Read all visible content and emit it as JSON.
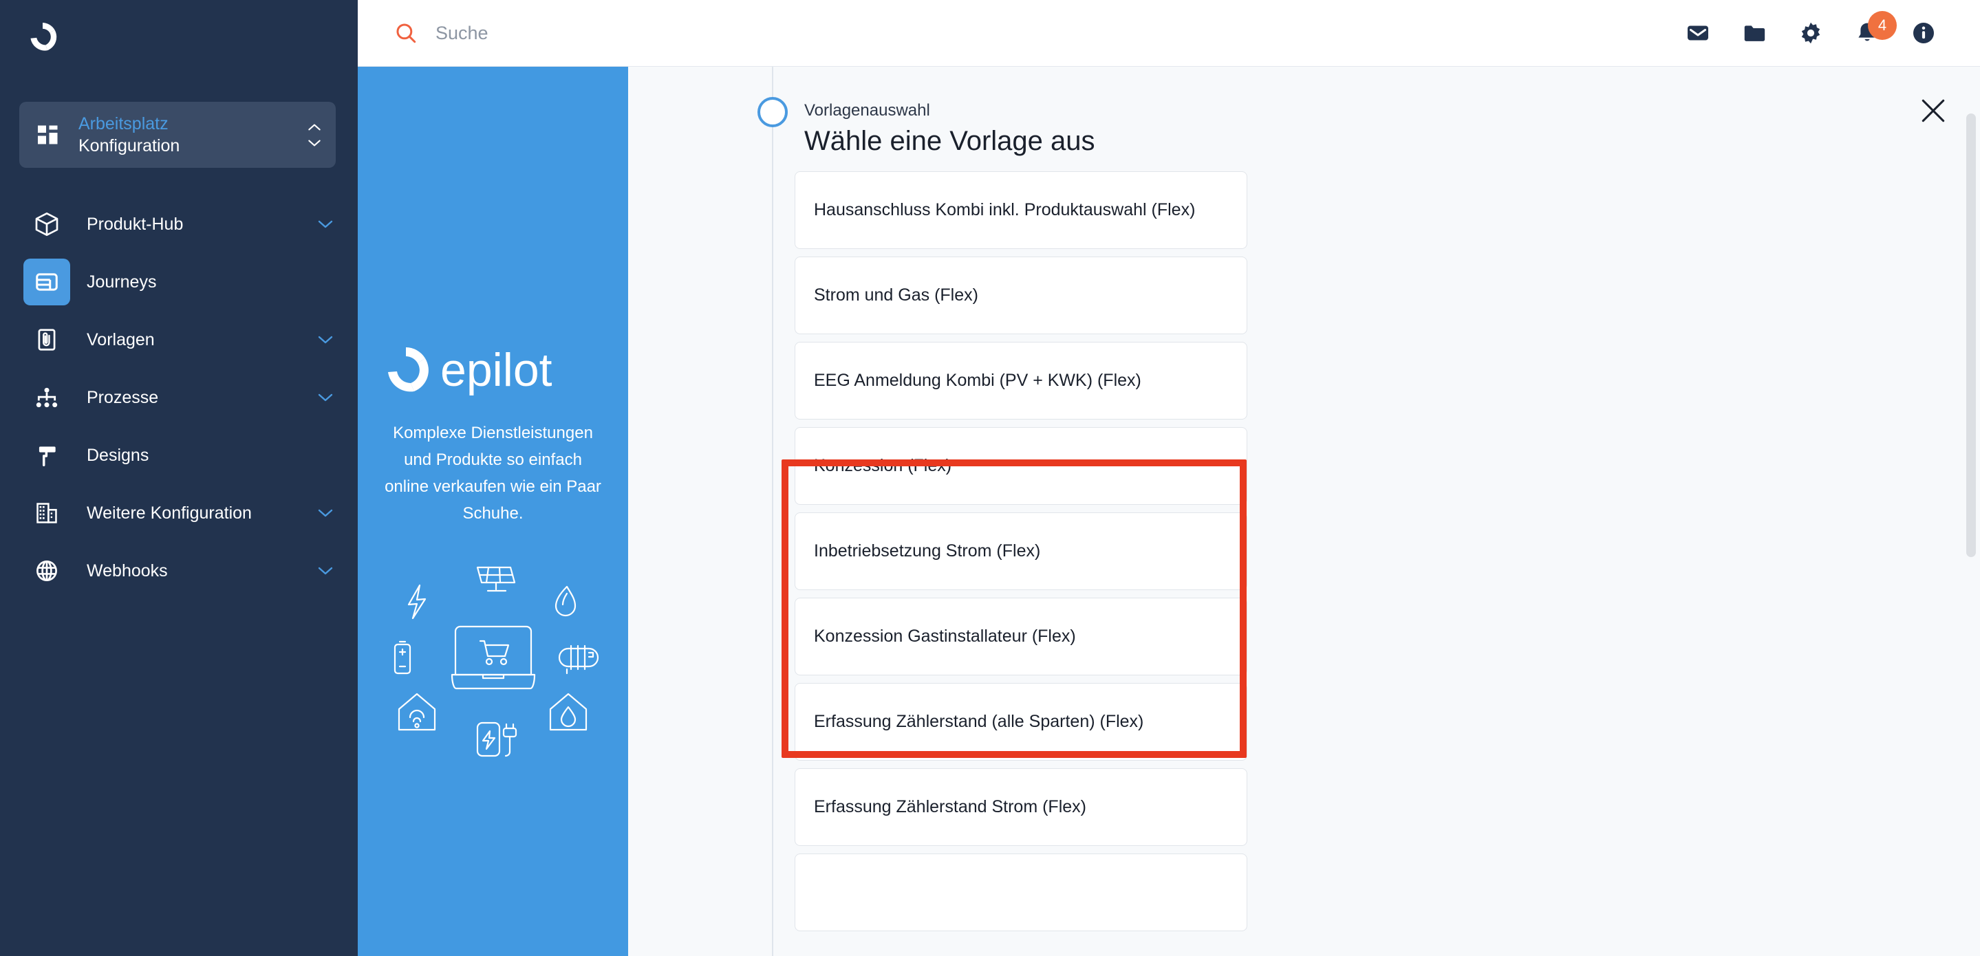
{
  "colors": {
    "sidebar_bg": "#22334e",
    "sidebar_card_bg": "#3a4b66",
    "accent_blue": "#4a9ae0",
    "promo_blue": "#4299e1",
    "search_icon_orange": "#f0613f",
    "badge_orange": "#f0713f",
    "annotation_red": "#e8391f",
    "content_bg": "#f7f9fb"
  },
  "sidebar": {
    "logo_name": "epilot-logo-icon",
    "workspace": {
      "icon": "grid-dashboard-icon",
      "top_label": "Arbeitsplatz",
      "bottom_label": "Konfiguration",
      "chevron_up_icon": "chevron-up-icon",
      "chevron_down_icon": "chevron-down-icon"
    },
    "items": [
      {
        "label": "Produkt-Hub",
        "icon": "cube-box-icon",
        "has_chevron": true,
        "active": false
      },
      {
        "label": "Journeys",
        "icon": "layout-panels-icon",
        "has_chevron": false,
        "active": true
      },
      {
        "label": "Vorlagen",
        "icon": "document-attachment-icon",
        "has_chevron": true,
        "active": false
      },
      {
        "label": "Prozesse",
        "icon": "hierarchy-nodes-icon",
        "has_chevron": true,
        "active": false
      },
      {
        "label": "Designs",
        "icon": "paint-roller-icon",
        "has_chevron": false,
        "active": false
      },
      {
        "label": "Weitere Konfiguration",
        "icon": "office-building-icon",
        "has_chevron": true,
        "active": false
      },
      {
        "label": "Webhooks",
        "icon": "globe-icon",
        "has_chevron": true,
        "active": false
      }
    ]
  },
  "topbar": {
    "search": {
      "icon": "search-icon",
      "placeholder": "Suche",
      "value": ""
    },
    "icons": [
      {
        "name": "mail-envelope-icon",
        "badge": ""
      },
      {
        "name": "folder-icon",
        "badge": ""
      },
      {
        "name": "gear-settings-icon",
        "badge": ""
      },
      {
        "name": "bell-notification-icon",
        "badge": "4"
      },
      {
        "name": "info-circle-icon",
        "badge": ""
      }
    ]
  },
  "promo": {
    "logo_text": "epilot",
    "logo_icon": "epilot-wordmark",
    "tagline": "Komplexe Dienstleistungen und Produkte so einfach online verkaufen wie ein Paar Schuhe.",
    "illustration_icons": [
      "solar-panel-icon",
      "flame-gas-icon",
      "lightning-bolt-icon",
      "battery-icon",
      "radiator-heating-icon",
      "laptop-shopping-cart-icon",
      "smart-home-wifi-icon",
      "water-house-icon",
      "ev-charger-icon"
    ]
  },
  "main": {
    "step_label": "Vorlagenauswahl",
    "step_dot_icon": "step-circle-empty-icon",
    "title": "Wähle eine Vorlage aus",
    "close_icon": "close-x-icon",
    "templates": [
      {
        "label": "Hausanschluss Kombi inkl. Produktauswahl (Flex)",
        "highlighted": false
      },
      {
        "label": "Strom und Gas (Flex)",
        "highlighted": false
      },
      {
        "label": "EEG Anmeldung Kombi (PV + KWK) (Flex)",
        "highlighted": false
      },
      {
        "label": "Konzession (Flex)",
        "highlighted": true
      },
      {
        "label": "Inbetriebsetzung Strom (Flex)",
        "highlighted": true
      },
      {
        "label": "Konzession Gastinstallateur (Flex)",
        "highlighted": true
      },
      {
        "label": "Erfassung Zählerstand (alle Sparten) (Flex)",
        "highlighted": false
      },
      {
        "label": "Erfassung Zählerstand Strom (Flex)",
        "highlighted": false
      },
      {
        "label": "",
        "highlighted": false
      }
    ],
    "annotation": {
      "name": "red-highlight-box",
      "covers": [
        "Konzession (Flex)",
        "Inbetriebsetzung Strom (Flex)",
        "Konzession Gastinstallateur (Flex)"
      ]
    },
    "scrollbar": {
      "name": "vertical-scrollbar"
    }
  }
}
